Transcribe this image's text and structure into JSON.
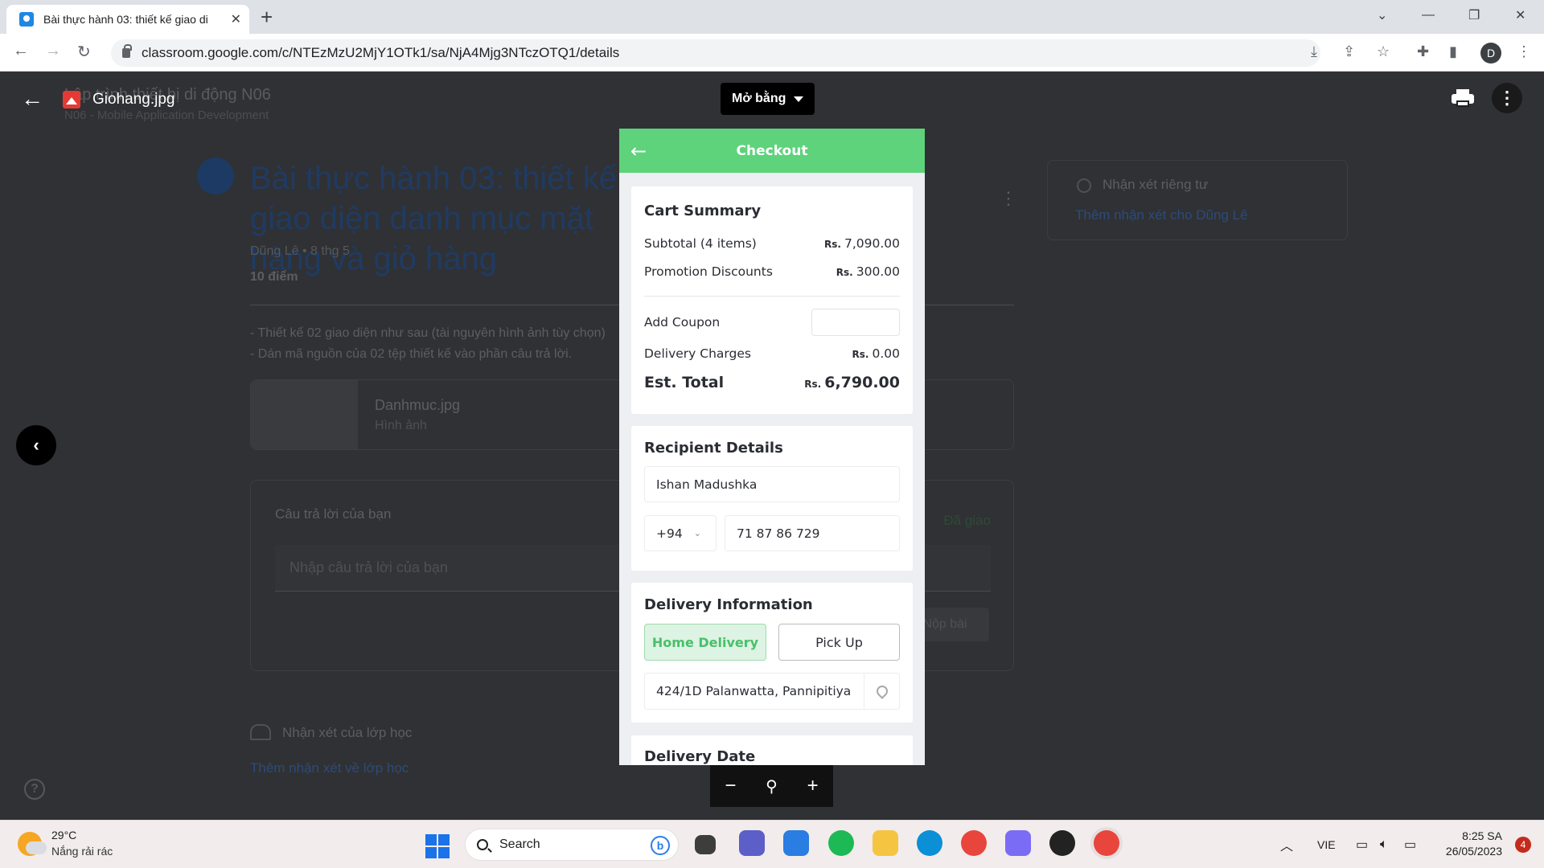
{
  "browser": {
    "tab_title": "Bài thực hành 03: thiết kế giao di",
    "tab_close": "✕",
    "new_tab": "+",
    "url": "classroom.google.com/c/NTEzMzU2MjY1OTk1/sa/NjA4Mjg3NTczOTQ1/details",
    "profile_initial": "D"
  },
  "classroom": {
    "course_name": "Lập trình thiết bị di động N06",
    "course_sub": "N06 - Mobile Application Development",
    "assignment_title": "Bài thực hành 03: thiết kế giao diện danh mục mặt hàng và giỏ hàng",
    "author_line": "Dũng Lê • 8 thg 5",
    "points": "10 điểm",
    "desc_line1": "- Thiết kế 02 giao diện như sau (tài nguyên hình ảnh tùy chọn)",
    "desc_line2": "- Dán mã nguồn của 02 tệp thiết kế vào phần câu trả lời.",
    "attachment_name": "Danhmuc.jpg",
    "attachment_type": "Hình ảnh",
    "answer_title": "Câu trả lời của bạn",
    "answer_status": "Đã giao",
    "answer_placeholder": "Nhập câu trả lời của bạn",
    "submit_label": "Nộp bài",
    "class_comments_label": "Nhận xét của lớp học",
    "add_class_comment": "Thêm nhận xét về lớp học",
    "private_comments_label": "Nhận xét riêng tư",
    "add_private_comment": "Thêm nhận xét cho Dũng Lê"
  },
  "viewer": {
    "file_name": "Giohang.jpg",
    "open_with_label": "Mở bằng",
    "more_icon": "more-vert-icon",
    "zoom_out": "−",
    "zoom_in": "+"
  },
  "checkout": {
    "header_title": "Checkout",
    "cart_summary_title": "Cart Summary",
    "subtotal_label": "Subtotal (4 items)",
    "subtotal_currency": "Rs.",
    "subtotal_value": "7,090.00",
    "promo_label": "Promotion Discounts",
    "promo_currency": "Rs.",
    "promo_value": "300.00",
    "coupon_label": "Add Coupon",
    "delivery_label": "Delivery Charges",
    "delivery_currency": "Rs.",
    "delivery_value": "0.00",
    "est_total_label": "Est. Total",
    "est_total_currency": "Rs.",
    "est_total_value": "6,790.00",
    "recipient_title": "Recipient Details",
    "recipient_name": "Ishan Madushka",
    "phone_code": "+94",
    "phone_number": "71 87 86 729",
    "delivery_info_title": "Delivery Information",
    "home_delivery_label": "Home Delivery",
    "pickup_label": "Pick Up",
    "address": "424/1D Palanwatta, Pannipitiya",
    "delivery_date_title": "Delivery Date",
    "accent_color": "#5fd27c"
  },
  "taskbar": {
    "temperature": "29°C",
    "weather": "Nắng rải rác",
    "search_label": "Search",
    "language": "VIE",
    "time": "8:25 SA",
    "date": "26/05/2023",
    "notifications": "4"
  }
}
